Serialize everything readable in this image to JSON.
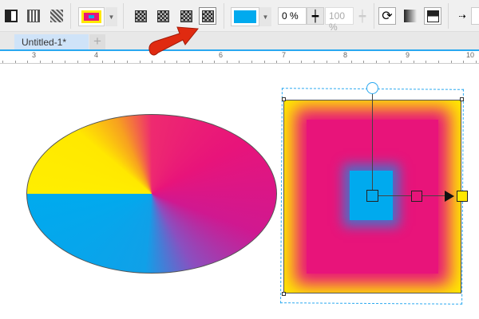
{
  "toolbar": {
    "fill_color": "#00aaee",
    "mid_position": "0 %",
    "opacity": "100 %",
    "icons": [
      "transparency-icon",
      "pattern-icon",
      "bitmap-pattern-icon",
      "fountain-fill-icon",
      "chevron-down-icon",
      "linear-fill-icon",
      "elliptical-fill-icon",
      "conical-fill-icon",
      "rectangular-fill-icon",
      "reverse-icon",
      "smooth-icon",
      "edit-fill-icon",
      "arrow-icon"
    ]
  },
  "tabs": [
    {
      "label": "Untitled-1*"
    }
  ],
  "ruler": {
    "labels": [
      "3",
      "4",
      "6",
      "7",
      "8",
      "9",
      "10"
    ]
  },
  "colors": {
    "yellow": "#ffe800",
    "magenta": "#e8147a",
    "blue": "#00aaee",
    "accent": "#29a8f0",
    "arrow": "#e02a10"
  }
}
